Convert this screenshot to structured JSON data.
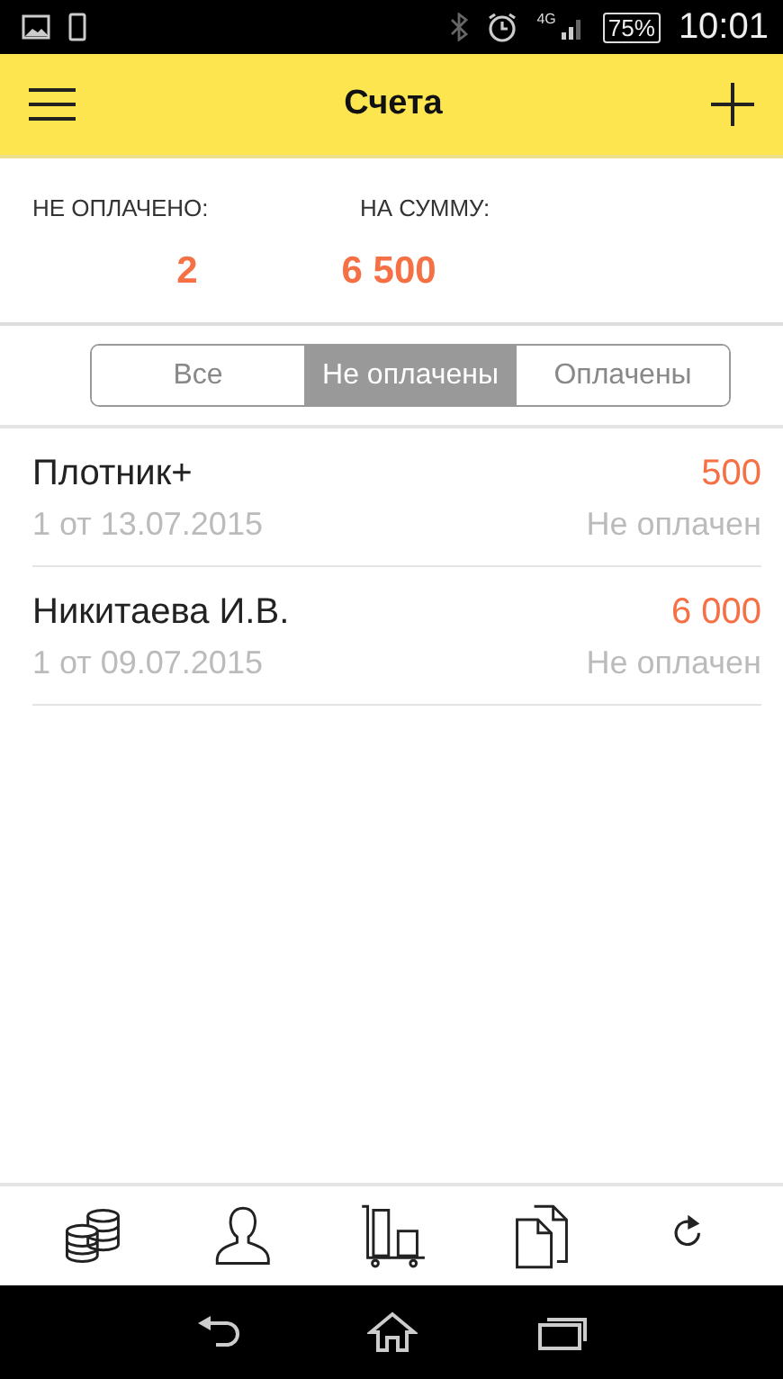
{
  "status_bar": {
    "network": "4G",
    "battery": "75%",
    "time": "10:01"
  },
  "app_bar": {
    "title": "Счета"
  },
  "summary": [
    {
      "label": "НЕ ОПЛАЧЕНО:",
      "value": "2"
    },
    {
      "label": "НА СУММУ:",
      "value": "6 500"
    }
  ],
  "filter_tabs": [
    {
      "label": "Все",
      "selected": false
    },
    {
      "label": "Не оплачены",
      "selected": true
    },
    {
      "label": "Оплачены",
      "selected": false
    }
  ],
  "invoices": [
    {
      "client": "Плотник+",
      "number": "1 от 13.07.2015",
      "amount": "500",
      "status": "Не оплачен"
    },
    {
      "client": "Никитаева И.В.",
      "number": "1 от 09.07.2015",
      "amount": "6 000",
      "status": "Не оплачен"
    }
  ],
  "toolbar": [
    {
      "kind": "coins"
    },
    {
      "kind": "person"
    },
    {
      "kind": "cart"
    },
    {
      "kind": "documents"
    },
    {
      "kind": "refresh"
    }
  ]
}
